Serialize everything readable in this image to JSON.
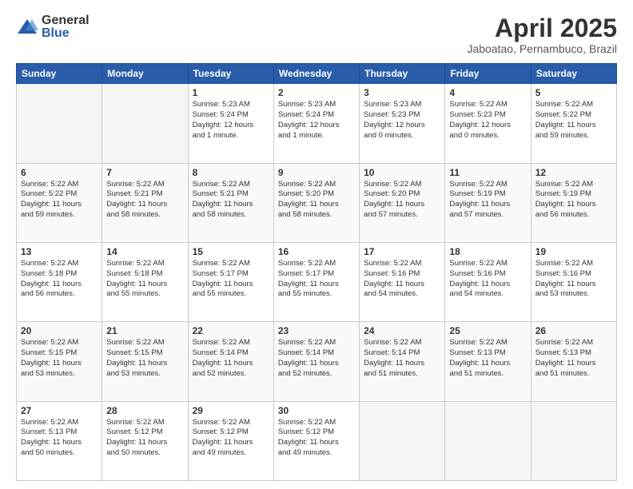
{
  "logo": {
    "general": "General",
    "blue": "Blue"
  },
  "title": "April 2025",
  "location": "Jaboatao, Pernambuco, Brazil",
  "weekdays": [
    "Sunday",
    "Monday",
    "Tuesday",
    "Wednesday",
    "Thursday",
    "Friday",
    "Saturday"
  ],
  "weeks": [
    [
      {
        "day": "",
        "info": ""
      },
      {
        "day": "",
        "info": ""
      },
      {
        "day": "1",
        "info": "Sunrise: 5:23 AM\nSunset: 5:24 PM\nDaylight: 12 hours\nand 1 minute."
      },
      {
        "day": "2",
        "info": "Sunrise: 5:23 AM\nSunset: 5:24 PM\nDaylight: 12 hours\nand 1 minute."
      },
      {
        "day": "3",
        "info": "Sunrise: 5:23 AM\nSunset: 5:23 PM\nDaylight: 12 hours\nand 0 minutes."
      },
      {
        "day": "4",
        "info": "Sunrise: 5:22 AM\nSunset: 5:23 PM\nDaylight: 12 hours\nand 0 minutes."
      },
      {
        "day": "5",
        "info": "Sunrise: 5:22 AM\nSunset: 5:22 PM\nDaylight: 11 hours\nand 59 minutes."
      }
    ],
    [
      {
        "day": "6",
        "info": "Sunrise: 5:22 AM\nSunset: 5:22 PM\nDaylight: 11 hours\nand 59 minutes."
      },
      {
        "day": "7",
        "info": "Sunrise: 5:22 AM\nSunset: 5:21 PM\nDaylight: 11 hours\nand 58 minutes."
      },
      {
        "day": "8",
        "info": "Sunrise: 5:22 AM\nSunset: 5:21 PM\nDaylight: 11 hours\nand 58 minutes."
      },
      {
        "day": "9",
        "info": "Sunrise: 5:22 AM\nSunset: 5:20 PM\nDaylight: 11 hours\nand 58 minutes."
      },
      {
        "day": "10",
        "info": "Sunrise: 5:22 AM\nSunset: 5:20 PM\nDaylight: 11 hours\nand 57 minutes."
      },
      {
        "day": "11",
        "info": "Sunrise: 5:22 AM\nSunset: 5:19 PM\nDaylight: 11 hours\nand 57 minutes."
      },
      {
        "day": "12",
        "info": "Sunrise: 5:22 AM\nSunset: 5:19 PM\nDaylight: 11 hours\nand 56 minutes."
      }
    ],
    [
      {
        "day": "13",
        "info": "Sunrise: 5:22 AM\nSunset: 5:18 PM\nDaylight: 11 hours\nand 56 minutes."
      },
      {
        "day": "14",
        "info": "Sunrise: 5:22 AM\nSunset: 5:18 PM\nDaylight: 11 hours\nand 55 minutes."
      },
      {
        "day": "15",
        "info": "Sunrise: 5:22 AM\nSunset: 5:17 PM\nDaylight: 11 hours\nand 55 minutes."
      },
      {
        "day": "16",
        "info": "Sunrise: 5:22 AM\nSunset: 5:17 PM\nDaylight: 11 hours\nand 55 minutes."
      },
      {
        "day": "17",
        "info": "Sunrise: 5:22 AM\nSunset: 5:16 PM\nDaylight: 11 hours\nand 54 minutes."
      },
      {
        "day": "18",
        "info": "Sunrise: 5:22 AM\nSunset: 5:16 PM\nDaylight: 11 hours\nand 54 minutes."
      },
      {
        "day": "19",
        "info": "Sunrise: 5:22 AM\nSunset: 5:16 PM\nDaylight: 11 hours\nand 53 minutes."
      }
    ],
    [
      {
        "day": "20",
        "info": "Sunrise: 5:22 AM\nSunset: 5:15 PM\nDaylight: 11 hours\nand 53 minutes."
      },
      {
        "day": "21",
        "info": "Sunrise: 5:22 AM\nSunset: 5:15 PM\nDaylight: 11 hours\nand 53 minutes."
      },
      {
        "day": "22",
        "info": "Sunrise: 5:22 AM\nSunset: 5:14 PM\nDaylight: 11 hours\nand 52 minutes."
      },
      {
        "day": "23",
        "info": "Sunrise: 5:22 AM\nSunset: 5:14 PM\nDaylight: 11 hours\nand 52 minutes."
      },
      {
        "day": "24",
        "info": "Sunrise: 5:22 AM\nSunset: 5:14 PM\nDaylight: 11 hours\nand 51 minutes."
      },
      {
        "day": "25",
        "info": "Sunrise: 5:22 AM\nSunset: 5:13 PM\nDaylight: 11 hours\nand 51 minutes."
      },
      {
        "day": "26",
        "info": "Sunrise: 5:22 AM\nSunset: 5:13 PM\nDaylight: 11 hours\nand 51 minutes."
      }
    ],
    [
      {
        "day": "27",
        "info": "Sunrise: 5:22 AM\nSunset: 5:13 PM\nDaylight: 11 hours\nand 50 minutes."
      },
      {
        "day": "28",
        "info": "Sunrise: 5:22 AM\nSunset: 5:12 PM\nDaylight: 11 hours\nand 50 minutes."
      },
      {
        "day": "29",
        "info": "Sunrise: 5:22 AM\nSunset: 5:12 PM\nDaylight: 11 hours\nand 49 minutes."
      },
      {
        "day": "30",
        "info": "Sunrise: 5:22 AM\nSunset: 5:12 PM\nDaylight: 11 hours\nand 49 minutes."
      },
      {
        "day": "",
        "info": ""
      },
      {
        "day": "",
        "info": ""
      },
      {
        "day": "",
        "info": ""
      }
    ]
  ]
}
